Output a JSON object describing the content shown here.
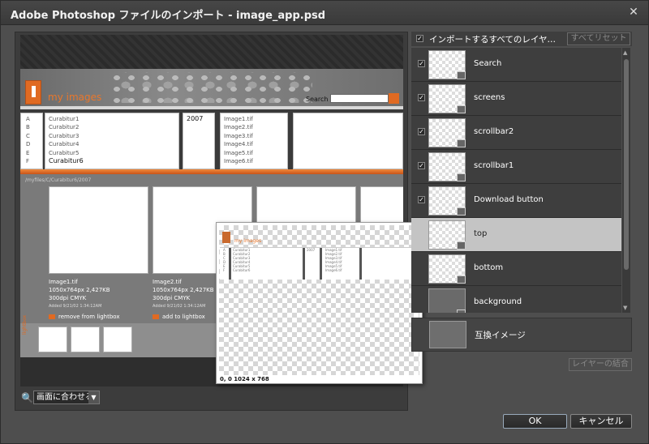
{
  "window": {
    "title": "Adobe Photoshop ファイルのインポート - image_app.psd",
    "close_glyph": "✕"
  },
  "preview": {
    "brand": "my images",
    "search_label": "Search",
    "column1_letters": [
      "A",
      "B",
      "C",
      "D",
      "E",
      "F"
    ],
    "column1_items": [
      "Curabitur1",
      "Curabitur2",
      "Curabitur3",
      "Curabitur4",
      "Curabitur5",
      "Curabitur6"
    ],
    "column2_items": [
      "2007"
    ],
    "column3_items": [
      "Image1.tif",
      "Image2.tif",
      "Image3.tif",
      "Image4.tif",
      "Image5.tif",
      "Image6.tif"
    ],
    "path": "/myfiles/C/Curabitur6/2007",
    "cards": [
      {
        "name": "Image1.tif",
        "dims": "1050x764px  2,427KB",
        "dpi": "300dpi CMYK",
        "added": "Added 9/21/02 1:34:12AM",
        "action": "remove from lightbox"
      },
      {
        "name": "Image2.tif",
        "dims": "1050x764px  2,427KB",
        "dpi": "300dpi CMYK",
        "added": "Added 9/21/02 1:34:12AM",
        "action": "add to lightbox"
      }
    ],
    "lightbox_label": "lightbox"
  },
  "popup": {
    "status": "0, 0    1024 x 768",
    "brand": "my images"
  },
  "zoom": {
    "icon": "magnifier-icon",
    "selected": "画面に合わせる"
  },
  "layers": {
    "select_all_label": "インポートするすべてのレイヤ…",
    "reset_label": "すべてリセット",
    "items": [
      {
        "name": "Search",
        "checked": true
      },
      {
        "name": "screens",
        "checked": true
      },
      {
        "name": "scrollbar2",
        "checked": true
      },
      {
        "name": "scrollbar1",
        "checked": true
      },
      {
        "name": "Download button",
        "checked": true
      },
      {
        "name": "top",
        "checked": false
      },
      {
        "name": "bottom",
        "checked": false
      },
      {
        "name": "background",
        "checked": false
      }
    ],
    "comp_label": "互換イメージ",
    "merge_label": "レイヤーの結合"
  },
  "buttons": {
    "ok": "OK",
    "cancel": "キャンセル"
  },
  "colors": {
    "accent": "#e06a22",
    "selected_row": "#c4c4c4"
  }
}
